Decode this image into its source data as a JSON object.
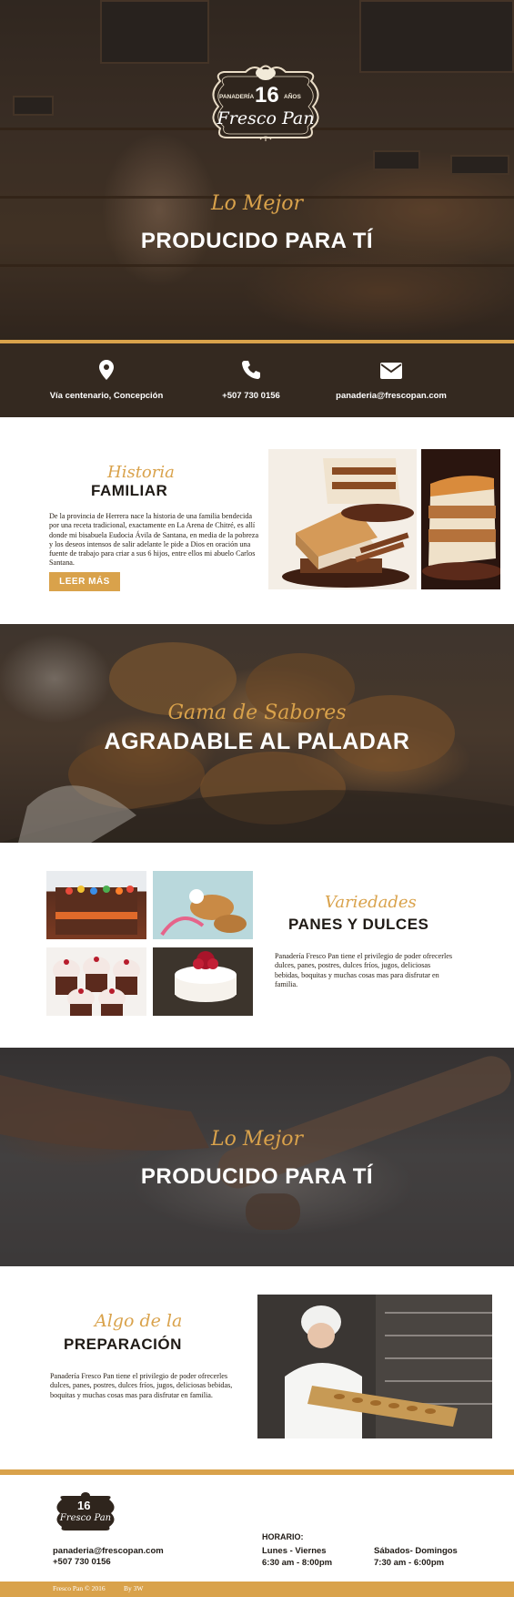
{
  "colors": {
    "accent": "#d9a24b",
    "dark_bar": "#342920",
    "text_dark": "#1f1a15",
    "white": "#ffffff"
  },
  "logo": {
    "word_panaderia": "PANADERÍA",
    "years_number": "16",
    "years_word": "AÑOS",
    "name": "Fresco Pan"
  },
  "hero": {
    "script": "Lo Mejor",
    "title": "PRODUCIDO PARA TÍ"
  },
  "contact": {
    "items": [
      {
        "icon": "location-pin-icon",
        "label": "Vía centenario, Concepción"
      },
      {
        "icon": "phone-icon",
        "label": "+507 730 0156"
      },
      {
        "icon": "envelope-icon",
        "label": "panaderia@frescopan.com"
      }
    ]
  },
  "historia": {
    "script": "Historia",
    "title": "FAMILIAR",
    "text": "De la provincia de Herrera nace la historia de una familia bendecida por una receta tradicional, exactamente en La Arena de Chitré, es allí donde mi bisabuela Eudocia Ávila de Santana, en media de la pobreza y los deseos intensos de salir adelante le pide a Dios en oración una fuente de trabajo para criar a sus 6 hijos, entre ellos mi abuelo Carlos Santana.",
    "button_label": "LEER MÁS"
  },
  "gama": {
    "script": "Gama de Sabores",
    "title": "AGRADABLE AL PALADAR"
  },
  "variedades": {
    "script": "Variedades",
    "title": "PANES Y DULCES",
    "text": "Panadería Fresco Pan tiene el privilegio de poder ofrecerles dulces, panes, postres, dulces fríos, jugos, deliciosas bebidas, boquitas y muchas cosas mas para disfrutar en familia."
  },
  "mejor2": {
    "script": "Lo Mejor",
    "title": "PRODUCIDO PARA TÍ"
  },
  "preparacion": {
    "script": "Algo de la",
    "title": "PREPARACIÓN",
    "text": "Panadería Fresco Pan tiene el privilegio de poder ofrecerles dulces, panes, postres, dulces fríos, jugos, deliciosas bebidas, boquitas y muchas cosas mas para disfrutar en familia."
  },
  "footer": {
    "email": "panaderia@frescopan.com",
    "phone": "+507 730 0156",
    "horario_heading": "HORARIO:",
    "schedule": [
      {
        "days": "Lunes - Viernes",
        "hours": "6:30 am - 8:00pm"
      },
      {
        "days": "Sábados- Domingos",
        "hours": "7:30 am - 6:00pm"
      }
    ],
    "copyright": "Fresco Pan © 2016",
    "credit": "By 3W"
  }
}
